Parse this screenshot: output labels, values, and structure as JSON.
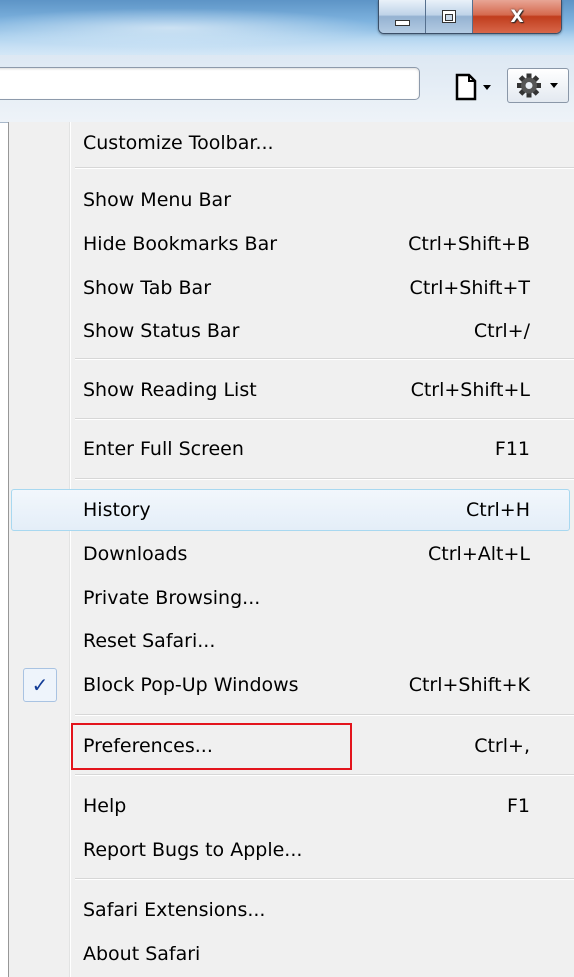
{
  "window": {
    "minimize_icon": "minimize-icon",
    "maximize_icon": "restore-icon",
    "close_glyph": "X",
    "close_icon": "close-icon"
  },
  "toolbar": {
    "address_value": "",
    "page_icon": "page-menu-icon",
    "gear_icon": "gear-icon"
  },
  "menu": {
    "customize": {
      "label": "Customize Toolbar..."
    },
    "show_menu_bar": {
      "label": "Show Menu Bar"
    },
    "hide_bookmarks": {
      "label": "Hide Bookmarks Bar",
      "shortcut": "Ctrl+Shift+B"
    },
    "show_tab_bar": {
      "label": "Show Tab Bar",
      "shortcut": "Ctrl+Shift+T"
    },
    "show_status_bar": {
      "label": "Show Status Bar",
      "shortcut": "Ctrl+/"
    },
    "show_reading_list": {
      "label": "Show Reading List",
      "shortcut": "Ctrl+Shift+L"
    },
    "full_screen": {
      "label": "Enter Full Screen",
      "shortcut": "F11"
    },
    "history": {
      "label": "History",
      "shortcut": "Ctrl+H"
    },
    "downloads": {
      "label": "Downloads",
      "shortcut": "Ctrl+Alt+L"
    },
    "private_browsing": {
      "label": "Private Browsing..."
    },
    "reset_safari": {
      "label": "Reset Safari..."
    },
    "block_popups": {
      "label": "Block Pop-Up Windows",
      "shortcut": "Ctrl+Shift+K",
      "check": "✓"
    },
    "preferences": {
      "label": "Preferences...",
      "shortcut": "Ctrl+,"
    },
    "help": {
      "label": "Help",
      "shortcut": "F1"
    },
    "report_bugs": {
      "label": "Report Bugs to Apple..."
    },
    "extensions": {
      "label": "Safari Extensions..."
    },
    "about": {
      "label": "About Safari"
    }
  },
  "colors": {
    "highlight_border": "#a8d8f0",
    "annotation": "#e3141c",
    "check": "#123c96"
  }
}
